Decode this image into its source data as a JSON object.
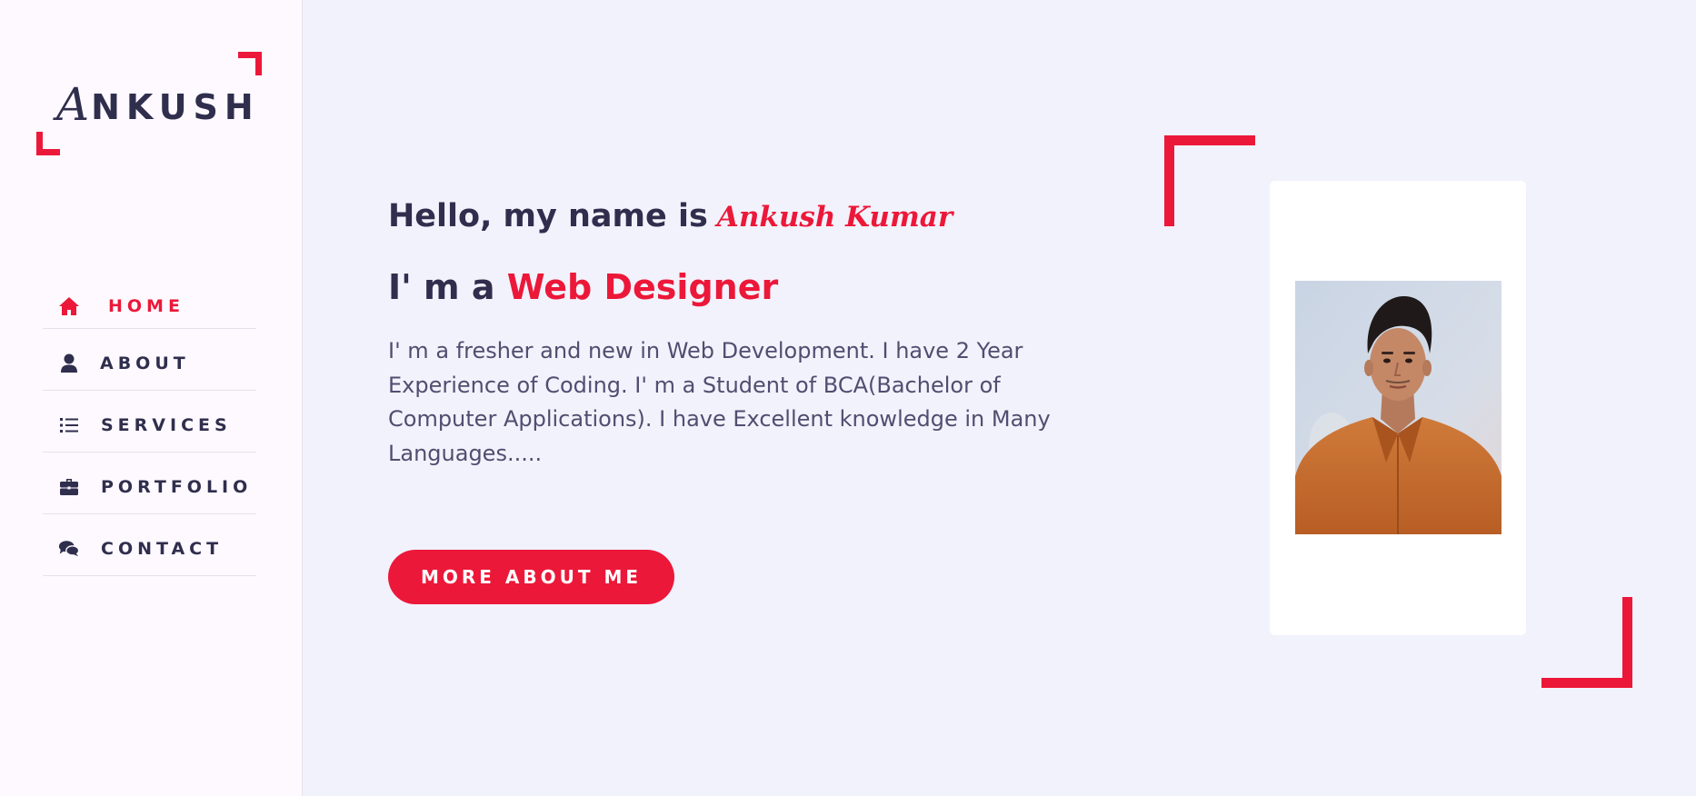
{
  "colors": {
    "accent": "#ec1839",
    "text_dark": "#302e4d",
    "text_body": "#504e70",
    "page_bg": "#f2f2fc",
    "sidebar_bg": "#fdf9ff"
  },
  "logo": {
    "initial": "A",
    "rest": "NKUSH"
  },
  "nav": {
    "items": [
      {
        "label": "HOME",
        "icon": "home-icon",
        "active": true
      },
      {
        "label": "ABOUT",
        "icon": "user-icon",
        "active": false
      },
      {
        "label": "SERVICES",
        "icon": "list-icon",
        "active": false
      },
      {
        "label": "PORTFOLIO",
        "icon": "briefcase-icon",
        "active": false
      },
      {
        "label": "CONTACT",
        "icon": "comments-icon",
        "active": false
      }
    ]
  },
  "hero": {
    "greeting": "Hello, my name is",
    "name": "Ankush Kumar",
    "role_prefix": "I' m a",
    "role_title": "Web Designer",
    "bio": "I' m a fresher and new in Web Development. I have 2 Year Experience of Coding. I' m a Student of BCA(Bachelor of Computer Applications). I have Excellent knowledge in Many Languages.....",
    "button_label": "MORE ABOUT ME"
  },
  "profile_photo": {
    "alt": "profile photo"
  }
}
